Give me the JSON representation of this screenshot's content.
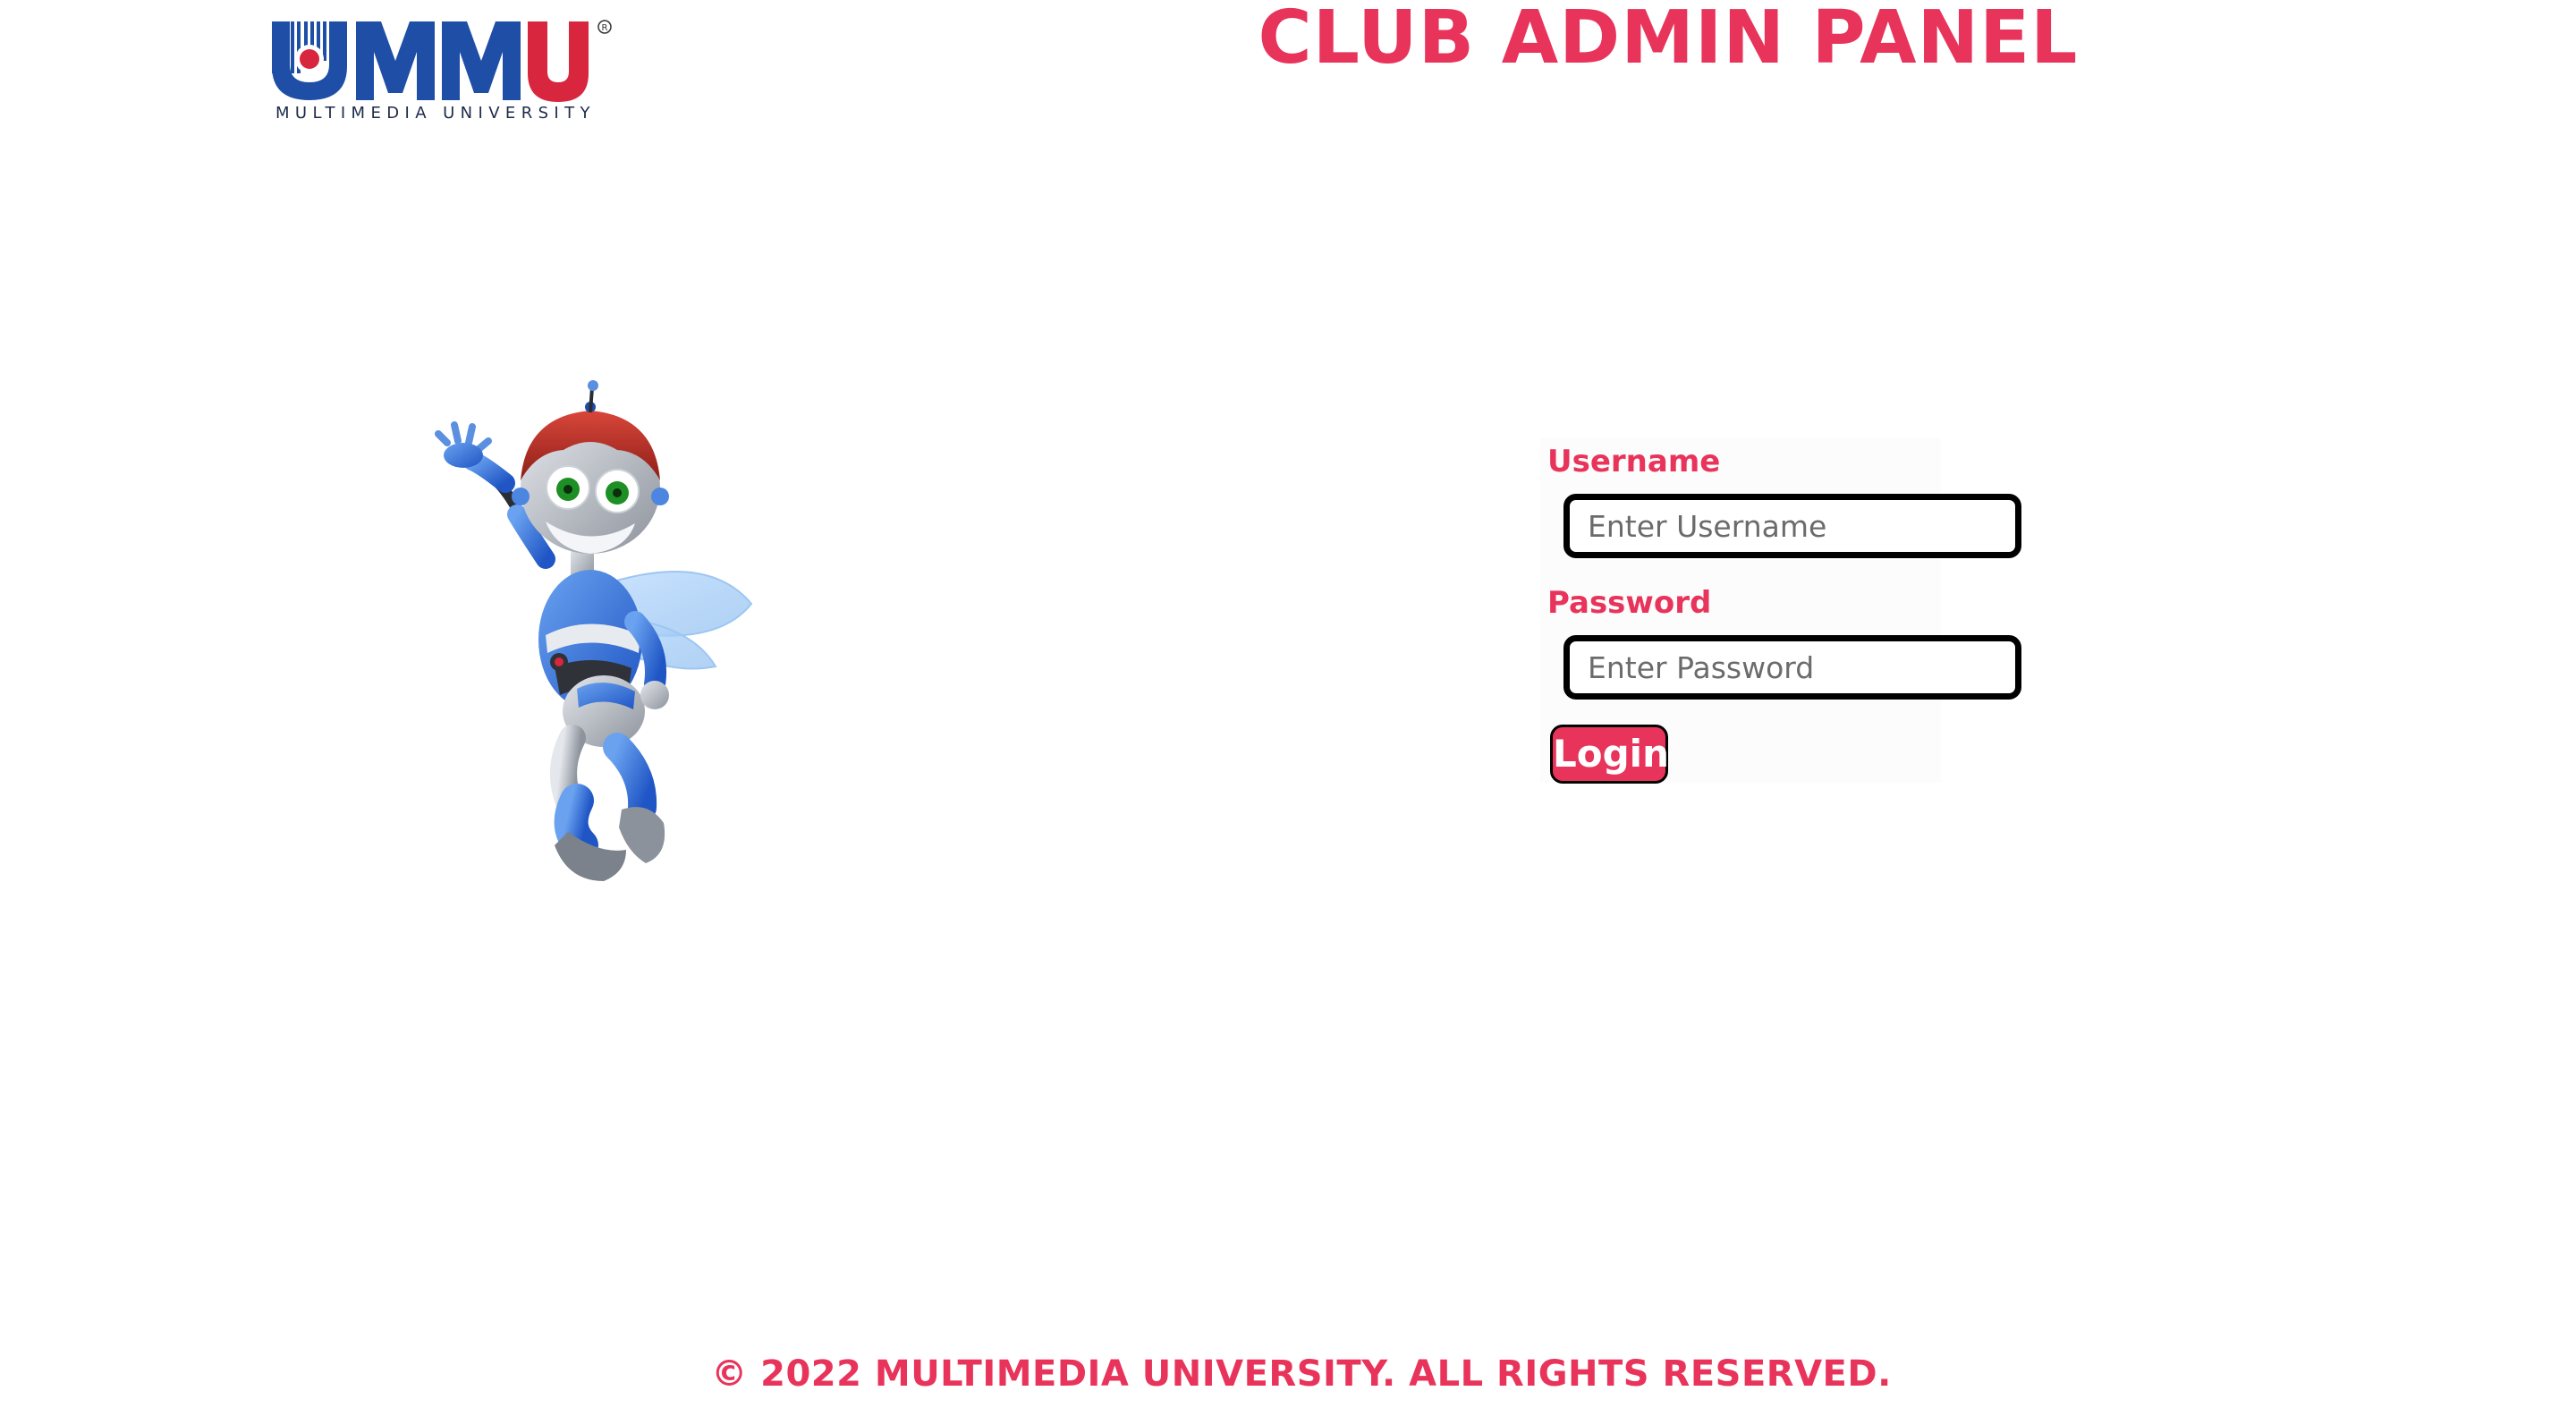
{
  "logo": {
    "brand_mark": "MMU",
    "university_name": "MULTIMEDIA UNIVERSITY",
    "registered_symbol": "®"
  },
  "header": {
    "title": "CLUB ADMIN PANEL"
  },
  "login_form": {
    "username_label": "Username",
    "username_placeholder": "Enter Username",
    "username_value": "",
    "password_label": "Password",
    "password_placeholder": "Enter Password",
    "password_value": "",
    "login_button_label": "Login"
  },
  "footer": {
    "copyright": "© 2022 MULTIMEDIA UNIVERSITY. ALL RIGHTS RESERVED."
  },
  "colors": {
    "accent": "#e8345b",
    "brand_blue": "#1e4ea6",
    "brand_red": "#d7263d",
    "input_border": "#000000"
  },
  "icons": {
    "logo": "mmu-logo",
    "mascot": "robot-bee-mascot-icon"
  }
}
